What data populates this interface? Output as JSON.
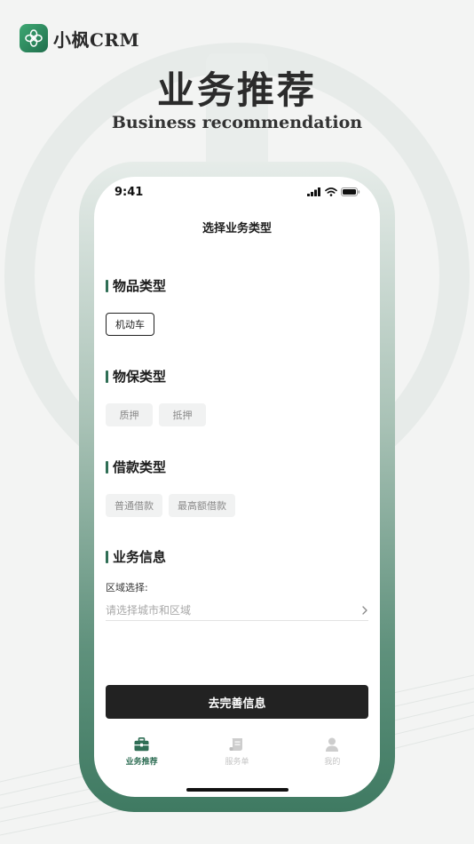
{
  "brand": {
    "name": "小枫CRM",
    "logo_icon": "clover-leaf-icon"
  },
  "hero": {
    "title": "业务推荐",
    "subtitle": "Business recommendation"
  },
  "status_bar": {
    "time": "9:41"
  },
  "screen": {
    "nav_title": "选择业务类型",
    "sections": [
      {
        "title": "物品类型",
        "options": [
          {
            "label": "机动车",
            "selected": true
          }
        ]
      },
      {
        "title": "物保类型",
        "options": [
          {
            "label": "质押",
            "selected": false
          },
          {
            "label": "抵押",
            "selected": false
          }
        ]
      },
      {
        "title": "借款类型",
        "options": [
          {
            "label": "普通借款",
            "selected": false
          },
          {
            "label": "最高额借款",
            "selected": false
          }
        ]
      }
    ],
    "business_info": {
      "title": "业务信息",
      "region_label": "区域选择:",
      "region_placeholder": "请选择城市和区域"
    },
    "submit_label": "去完善信息"
  },
  "tabbar": [
    {
      "label": "业务推荐",
      "icon": "briefcase-icon",
      "active": true
    },
    {
      "label": "服务单",
      "icon": "scroll-icon",
      "active": false
    },
    {
      "label": "我的",
      "icon": "person-icon",
      "active": false
    }
  ],
  "colors": {
    "accent": "#2f6e55",
    "button": "#222222",
    "frame_bottom": "#3f7a62"
  }
}
